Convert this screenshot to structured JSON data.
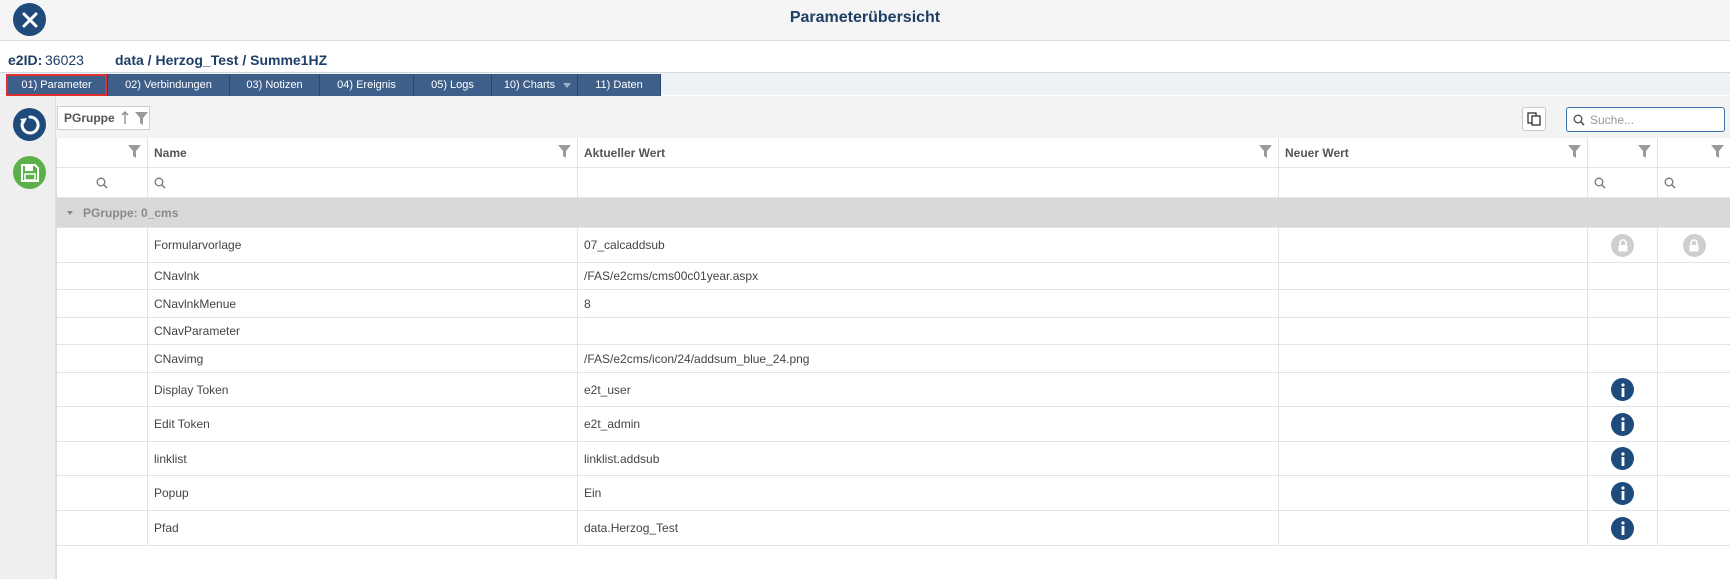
{
  "window": {
    "title": "Parameterübersicht"
  },
  "info": {
    "e2id_label": "e2ID:",
    "e2id_value": "36023",
    "path": "data / Herzog_Test / Summe1HZ"
  },
  "tabs": [
    {
      "label": "01) Parameter",
      "active": true
    },
    {
      "label": "02) Verbindungen",
      "active": false
    },
    {
      "label": "03) Notizen",
      "active": false
    },
    {
      "label": "04) Ereignis",
      "active": false
    },
    {
      "label": "05) Logs",
      "active": false
    },
    {
      "label": "10) Charts",
      "active": false,
      "dropdown": true
    },
    {
      "label": "11) Daten",
      "active": false
    }
  ],
  "toolbar": {
    "group_by_label": "PGruppe",
    "search_placeholder": "Suche..."
  },
  "grid": {
    "columns": [
      "",
      "Name",
      "Aktueller Wert",
      "Neuer Wert",
      "",
      ""
    ],
    "group_label": "PGruppe: 0_cms",
    "rows": [
      {
        "name": "Formularvorlage",
        "current": "07_calcaddsub",
        "new": "",
        "icon_a": "lock-icon",
        "icon_b": "lock-icon"
      },
      {
        "name": "CNavlnk",
        "current": "/FAS/e2cms/cms00c01year.aspx",
        "new": "",
        "icon_a": "",
        "icon_b": ""
      },
      {
        "name": "CNavlnkMenue",
        "current": "8",
        "new": "",
        "icon_a": "",
        "icon_b": ""
      },
      {
        "name": "CNavParameter",
        "current": "",
        "new": "",
        "icon_a": "",
        "icon_b": ""
      },
      {
        "name": "CNavimg",
        "current": "/FAS/e2cms/icon/24/addsum_blue_24.png",
        "new": "",
        "icon_a": "",
        "icon_b": ""
      },
      {
        "name": "Display Token",
        "current": "e2t_user",
        "new": "",
        "icon_a": "info-icon",
        "icon_b": ""
      },
      {
        "name": "Edit Token",
        "current": "e2t_admin",
        "new": "",
        "icon_a": "info-icon",
        "icon_b": ""
      },
      {
        "name": "linklist",
        "current": "linklist.addsub",
        "new": "",
        "icon_a": "info-icon",
        "icon_b": ""
      },
      {
        "name": "Popup",
        "current": "Ein",
        "new": "",
        "icon_a": "info-icon",
        "icon_b": ""
      },
      {
        "name": "Pfad",
        "current": "data.Herzog_Test",
        "new": "",
        "icon_a": "info-icon",
        "icon_b": ""
      }
    ]
  },
  "colors": {
    "primary": "#1f4a7c",
    "tab": "#3e5f8a",
    "save": "#5cb04a",
    "group_row": "#d9d9d9",
    "active_tab_outline": "#e03030"
  }
}
